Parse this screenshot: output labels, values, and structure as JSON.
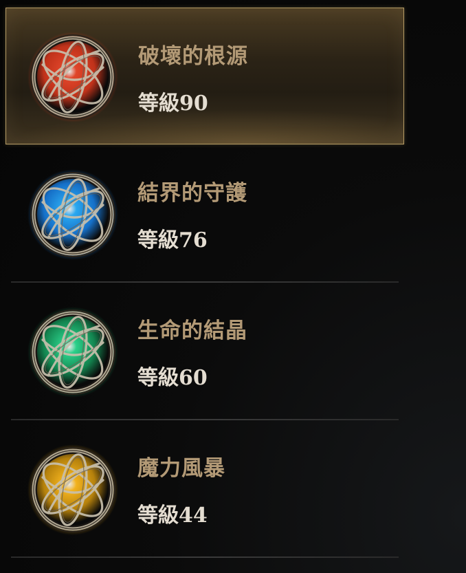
{
  "skills": [
    {
      "name": "破壞的根源",
      "level": "等級90",
      "icon": "red-orb-icon",
      "color": "#e0452a",
      "glow": "#c0321a"
    },
    {
      "name": "結界的守護",
      "level": "等級76",
      "icon": "blue-orb-icon",
      "color": "#2aa8f0",
      "glow": "#1670c8"
    },
    {
      "name": "生命的結晶",
      "level": "等級60",
      "icon": "green-orb-icon",
      "color": "#2bd08a",
      "glow": "#13844f"
    },
    {
      "name": "魔力風暴",
      "level": "等級44",
      "icon": "gold-orb-icon",
      "color": "#f2b21e",
      "glow": "#b5810c"
    }
  ],
  "selected_index": 0
}
